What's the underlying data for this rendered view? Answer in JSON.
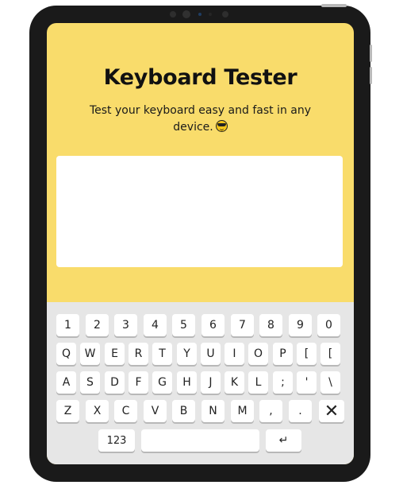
{
  "app": {
    "title": "Keyboard Tester",
    "subtitle": "Test your keyboard easy and fast in any device.",
    "emoji_icon": "sunglasses-emoji-icon",
    "text_area_value": ""
  },
  "keyboard": {
    "rows": [
      [
        "1",
        "2",
        "3",
        "4",
        "5",
        "6",
        "7",
        "8",
        "9",
        "0"
      ],
      [
        "Q",
        "W",
        "E",
        "R",
        "T",
        "Y",
        "U",
        "I",
        "O",
        "P",
        "[",
        "["
      ],
      [
        "A",
        "S",
        "D",
        "F",
        "G",
        "H",
        "J",
        "K",
        "L",
        ";",
        "'",
        "\\"
      ],
      [
        "Z",
        "X",
        "C",
        "V",
        "B",
        "N",
        "M",
        ",",
        "."
      ]
    ],
    "delete_label": "✕",
    "mode_label": "123",
    "space_label": "",
    "enter_label": "↵"
  },
  "colors": {
    "screen_bg": "#f9dc6b",
    "keyboard_bg": "#e6e6e6",
    "frame": "#1a1a1a"
  }
}
